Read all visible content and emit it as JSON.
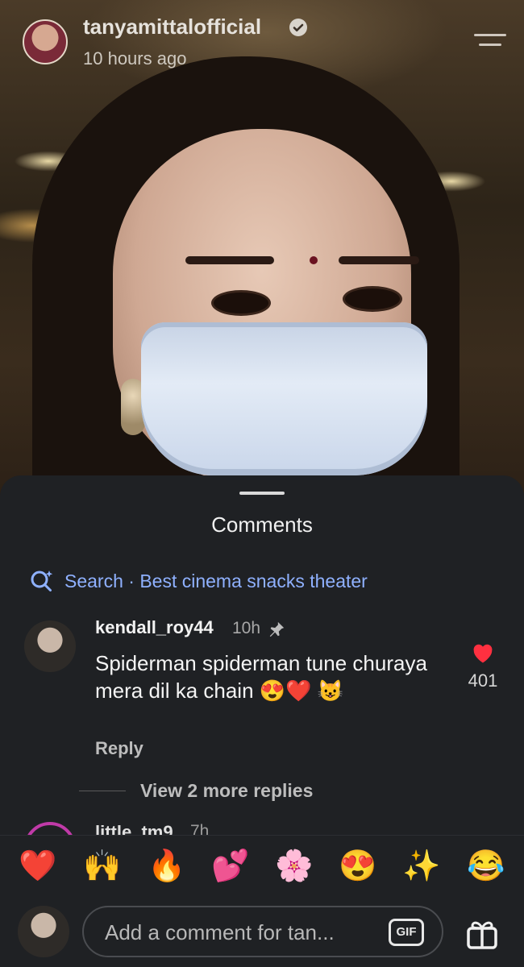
{
  "header": {
    "username": "tanyamittalofficial",
    "time_ago": "10 hours ago"
  },
  "sheet": {
    "title": "Comments",
    "search_text": "Search · Best cinema snacks theater"
  },
  "comment": {
    "user": "kendall_roy44",
    "time": "10h",
    "text": "Spiderman spiderman tune churaya mera dil ka chain 😍❤️ 😺",
    "reply_label": "Reply",
    "likes": "401",
    "view_more": "View 2 more replies"
  },
  "next_comment": {
    "user": "little_tm9",
    "time": "7h"
  },
  "emoji_bar": [
    "❤️",
    "🙌",
    "🔥",
    "💕",
    "🌸",
    "😍",
    "✨",
    "😂"
  ],
  "composer": {
    "placeholder": "Add a comment for tan...",
    "gif_label": "GIF"
  },
  "colors": {
    "sheet_bg": "#1f2124",
    "link_blue": "#8fb1ff",
    "like_red": "#ff3040"
  }
}
